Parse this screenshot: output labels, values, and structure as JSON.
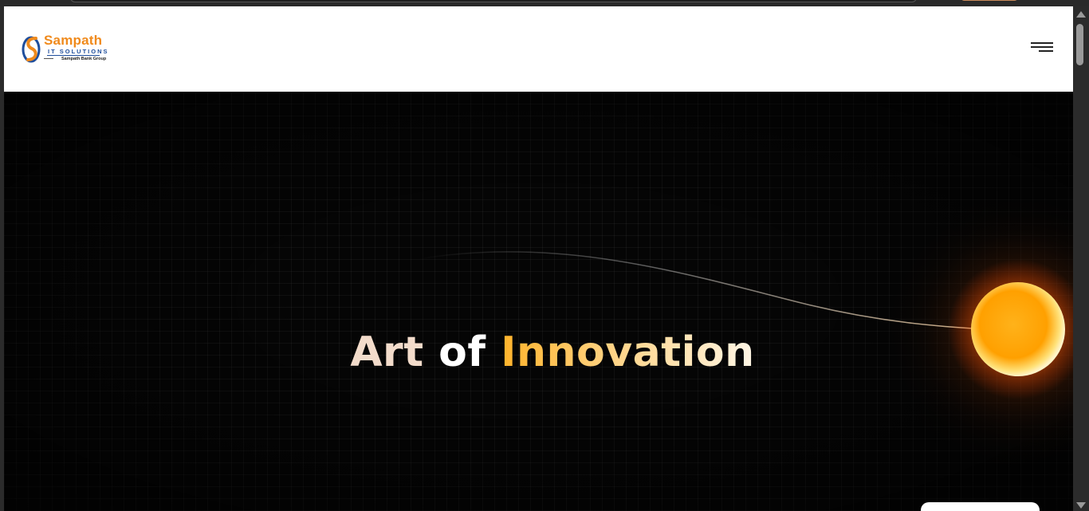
{
  "brand": {
    "name": "Sampath",
    "tagline": "IT SOLUTIONS",
    "group": "Sampath Bank Group",
    "primary_color": "#f08a1c",
    "secondary_color": "#1f4e9c"
  },
  "header": {
    "menu_icon": "hamburger-menu-icon"
  },
  "hero": {
    "title_parts": [
      "Art",
      "of",
      "Innovation"
    ],
    "accent_color": "#ffb32a",
    "orb_icon": "glowing-sun-orb"
  }
}
